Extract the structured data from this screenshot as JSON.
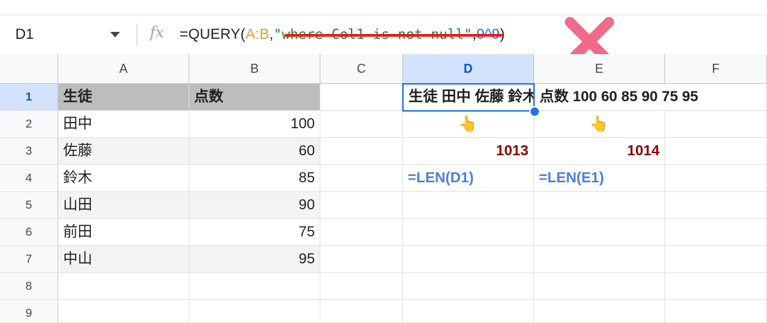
{
  "name_box": "D1",
  "formula_bar": {
    "fx_icon": "fx-icon",
    "prefix": "=QUERY(",
    "range": "A:B",
    "comma1": ",",
    "string": "\"where Col1 is not null\"",
    "comma2": ",",
    "number": "9^9",
    "suffix": ")"
  },
  "colors": {
    "range": "#e69b22",
    "string": "#188038",
    "number": "#1a73e8",
    "underline": "#e0211b",
    "x_mark": "#f06a8a",
    "selection": "#1a73e8"
  },
  "columns": [
    "A",
    "B",
    "C",
    "D",
    "E",
    "F"
  ],
  "rows": [
    "1",
    "2",
    "3",
    "4",
    "5",
    "6",
    "7",
    "8",
    "9"
  ],
  "table": {
    "header": [
      "生徒",
      "点数"
    ],
    "data": [
      [
        "田中",
        "100"
      ],
      [
        "佐藤",
        "60"
      ],
      [
        "鈴木",
        "85"
      ],
      [
        "山田",
        "90"
      ],
      [
        "前田",
        "75"
      ],
      [
        "中山",
        "95"
      ]
    ]
  },
  "results": {
    "d1": "生徒 田中 佐藤 鈴木 山田 前田 中山",
    "e1": "点数 100 60 85 90 75 95",
    "d2_icon": "👆",
    "e2_icon": "👆",
    "d3": "1013",
    "e3": "1014",
    "d4": "=LEN(D1)",
    "e4": "=LEN(E1)"
  },
  "icons": {
    "x_mark": "x-mark-icon",
    "dropdown": "chevron-down-icon",
    "pointer": "pointing-hand-icon"
  }
}
